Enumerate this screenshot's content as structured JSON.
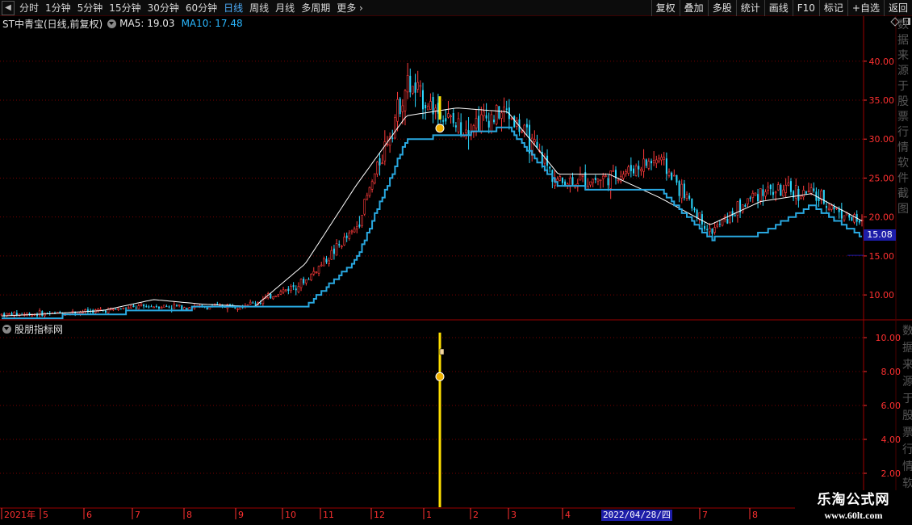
{
  "toolbar": {
    "periods": [
      {
        "label": "分时",
        "active": false
      },
      {
        "label": "1分钟",
        "active": false
      },
      {
        "label": "5分钟",
        "active": false
      },
      {
        "label": "15分钟",
        "active": false
      },
      {
        "label": "30分钟",
        "active": false
      },
      {
        "label": "60分钟",
        "active": false
      },
      {
        "label": "日线",
        "active": true
      },
      {
        "label": "周线",
        "active": false
      },
      {
        "label": "月线",
        "active": false
      },
      {
        "label": "多周期",
        "active": false
      },
      {
        "label": "更多",
        "active": false
      }
    ],
    "right_buttons": [
      "复权",
      "叠加",
      "多股",
      "统计",
      "画线",
      "F10",
      "标记",
      "+自选",
      "返回"
    ]
  },
  "info": {
    "stock_name": "ST中青宝(日线,前复权)",
    "ma5": "MA5: 19.03",
    "ma10": "MA10: 17.48"
  },
  "sub_panel": {
    "title": "股朋指标网"
  },
  "price_tag": "15.08",
  "date_label": "2022/04/28/四",
  "watermark": {
    "title": "乐淘公式网",
    "url": "www.60lt.com"
  },
  "gutter_text": "数据来源于股票行情软件截图",
  "colors": {
    "up": "#ff3b3b",
    "down": "#2ad8ff",
    "ma_white": "#ffffff",
    "line_blue": "#29a8e0",
    "signal": "#ffe000",
    "grid": "#7a0000",
    "axis_text": "#ff3030"
  },
  "chart_data": [
    {
      "type": "candlestick",
      "y_ticks": [
        "10.00",
        "15.00",
        "20.00",
        "25.00",
        "30.00",
        "35.00",
        "40.00"
      ],
      "ylim": [
        6.8,
        43.5
      ],
      "x_months": [
        "2021年",
        "5",
        "6",
        "7",
        "8",
        "9",
        "10",
        "11",
        "12",
        "1",
        "2",
        "3",
        "4",
        "2022/04/28/四",
        "7",
        "8"
      ],
      "close_approx": [
        7.5,
        7.6,
        8.0,
        8.6,
        8.4,
        8.9,
        11.8,
        18.5,
        37.0,
        31.5,
        33.5,
        24.5,
        25.0,
        27.5,
        18.0,
        23.5,
        23.0,
        19.0
      ],
      "white_line_approx": [
        7.3,
        7.6,
        8.0,
        9.4,
        8.8,
        8.5,
        14.0,
        24.0,
        33.0,
        34.0,
        33.5,
        25.5,
        25.5,
        22.5,
        19.0,
        22.0,
        23.0,
        19.5
      ],
      "blue_line_approx": [
        7.0,
        7.2,
        7.5,
        8.1,
        8.3,
        8.3,
        8.5,
        14.5,
        30.0,
        30.5,
        31.5,
        24.0,
        23.5,
        23.5,
        17.2,
        17.8,
        21.5,
        17.5
      ],
      "last_price": 15.08
    },
    {
      "type": "indicator",
      "y_ticks": [
        "2.00",
        "4.00",
        "6.00",
        "8.00",
        "10.00"
      ],
      "ylim": [
        0,
        11
      ],
      "signal_bar": {
        "date_index_month": "1",
        "value": 10
      }
    }
  ]
}
